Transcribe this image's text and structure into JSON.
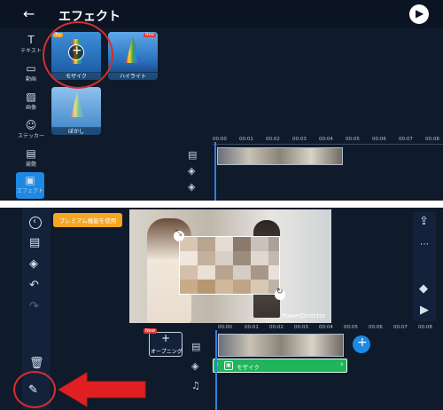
{
  "top": {
    "title": "エフェクト",
    "back_icon": "back-arrow-icon",
    "play_icon": "play-icon",
    "sidebar": [
      {
        "label": "テキスト",
        "icon": "text-icon"
      },
      {
        "label": "動画",
        "icon": "video-icon"
      },
      {
        "label": "画像",
        "icon": "image-icon"
      },
      {
        "label": "ステッカー",
        "icon": "sticker-icon"
      },
      {
        "label": "競艶",
        "icon": "layers-icon"
      },
      {
        "label": "エフェクト",
        "icon": "effect-icon",
        "active": true
      }
    ],
    "effects": [
      {
        "label": "モザイク",
        "badge": "Try"
      },
      {
        "label": "ハイライト",
        "badge": "New"
      },
      {
        "label": "ぼかし",
        "badge": ""
      }
    ],
    "ruler": [
      "00:00",
      "00:01",
      "00:02",
      "00:03",
      "00:04",
      "00:05",
      "00:06",
      "00:07",
      "00:08"
    ]
  },
  "bottom": {
    "premium_label": "プレミアム機能を使用",
    "watermark": "PowerDirector",
    "opening_label": "オープニング",
    "opening_badge": "New",
    "clip_label": "モザイク",
    "ruler": [
      "00:00",
      "00:01",
      "00:02",
      "00:03",
      "00:04",
      "00:05",
      "00:06",
      "00:07",
      "00:08"
    ],
    "colors": {
      "accent": "#1e88e5",
      "premium": "#f5a623",
      "clip": "#1fb55a",
      "highlight": "#d32f2f"
    }
  }
}
